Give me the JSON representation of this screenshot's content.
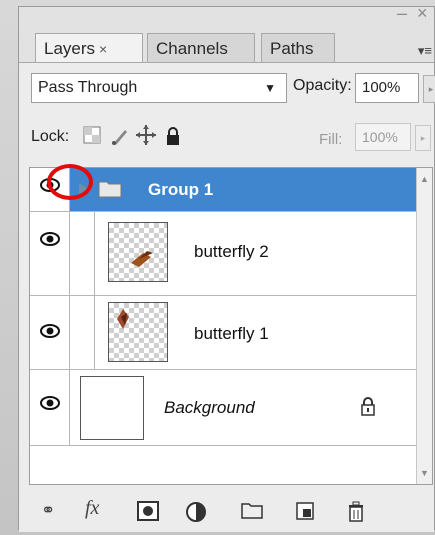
{
  "window": {
    "minimize_label": "–",
    "close_label": "×"
  },
  "tabs": [
    {
      "label": "Layers",
      "close": "×"
    },
    {
      "label": "Channels"
    },
    {
      "label": "Paths"
    }
  ],
  "panel_menu_icon": "▾≡",
  "blend_mode": {
    "value": "Pass Through",
    "arrow": "▼"
  },
  "opacity": {
    "label": "Opacity:",
    "value": "100%",
    "arrow": "▸"
  },
  "lock": {
    "label": "Lock:",
    "icons": [
      "lock-transparent-icon",
      "lock-image-icon",
      "lock-position-icon",
      "lock-all-icon"
    ]
  },
  "fill": {
    "label": "Fill:",
    "value": "100%",
    "arrow": "▸"
  },
  "layers": [
    {
      "name": "Group 1",
      "type": "group",
      "visible": true,
      "selected": true
    },
    {
      "name": "butterfly 2",
      "type": "layer",
      "visible": true
    },
    {
      "name": "butterfly 1",
      "type": "layer",
      "visible": true
    },
    {
      "name": "Background",
      "type": "background",
      "visible": true,
      "locked": true
    }
  ],
  "bottom_toolbar": [
    "link-layers-icon",
    "fx-icon",
    "layer-mask-icon",
    "adjustment-layer-icon",
    "new-group-icon",
    "new-layer-icon",
    "trash-icon"
  ],
  "bottom_labels": {
    "link": "⚭",
    "fx": "fx",
    "mask": "◘",
    "adjust": "◐",
    "group": "▭",
    "new": "▣",
    "trash": "🗑"
  },
  "colors": {
    "selection": "#3f86cf",
    "highlight_ring": "#e30c0c"
  }
}
